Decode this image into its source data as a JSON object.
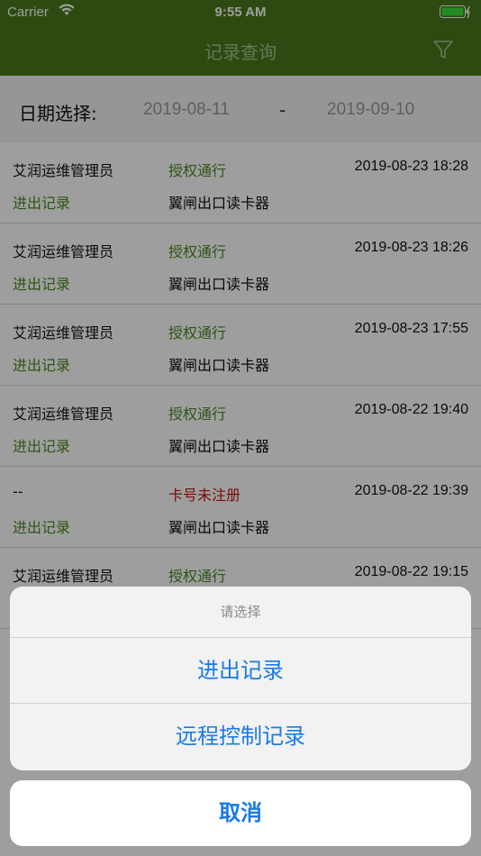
{
  "status_bar": {
    "carrier": "Carrier",
    "time": "9:55 AM"
  },
  "nav": {
    "title": "记录查询",
    "filter_icon": "filter-icon"
  },
  "date_filter": {
    "label": "日期选择:",
    "start": "2019-08-11",
    "separator": "-",
    "end": "2019-09-10"
  },
  "records": [
    {
      "user": "艾润运维管理员",
      "status": "授权通行",
      "time": "2019-08-23 18:28",
      "type": "进出记录",
      "device": "翼闸出口读卡器"
    },
    {
      "user": "艾润运维管理员",
      "status": "授权通行",
      "time": "2019-08-23 18:26",
      "type": "进出记录",
      "device": "翼闸出口读卡器"
    },
    {
      "user": "艾润运维管理员",
      "status": "授权通行",
      "time": "2019-08-23 17:55",
      "type": "进出记录",
      "device": "翼闸出口读卡器"
    },
    {
      "user": "艾润运维管理员",
      "status": "授权通行",
      "time": "2019-08-22 19:40",
      "type": "进出记录",
      "device": "翼闸出口读卡器"
    },
    {
      "user": "--",
      "status": "卡号未注册",
      "time": "2019-08-22 19:39",
      "type": "进出记录",
      "device": "翼闸出口读卡器"
    },
    {
      "user": "艾润运维管理员",
      "status": "授权通行",
      "time": "2019-08-22 19:15",
      "type": "",
      "device": ""
    }
  ],
  "action_sheet": {
    "title": "请选择",
    "options": [
      "进出记录",
      "远程控制记录"
    ],
    "cancel": "取消"
  },
  "colors": {
    "nav_bg": "#4a7a1a",
    "ok_status": "#4a8a22",
    "error_status": "#cc1111",
    "action_blue": "#1a7ae6"
  }
}
